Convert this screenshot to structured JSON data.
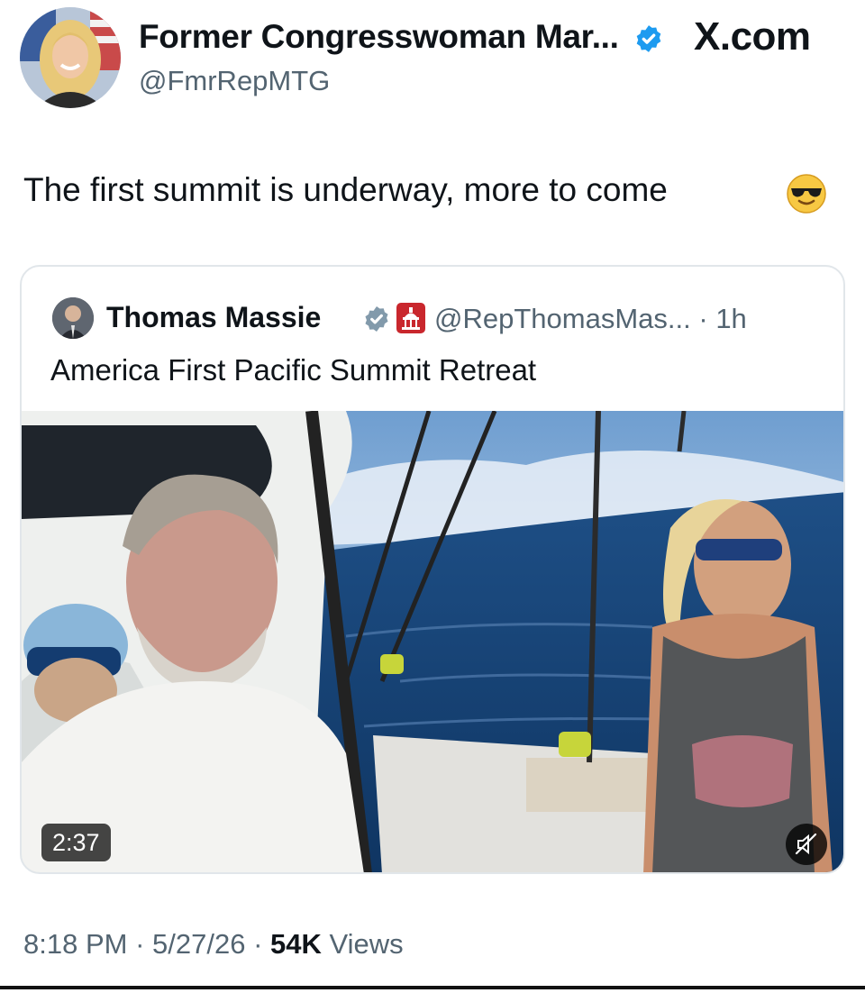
{
  "post": {
    "author": {
      "display_name": "Former Congresswoman Mar...",
      "handle": "@FmrRepMTG",
      "verified": true,
      "avatar_icon": "profile-avatar"
    },
    "source_site": "X.com",
    "text": "The first summit is underway, more to come",
    "emoji": "smiling-face-with-sunglasses",
    "quoted_post": {
      "author": {
        "display_name": "Thomas Massie",
        "handle": "@RepThomasMas...",
        "verified": true,
        "affiliation_badge": "capitol-badge-icon"
      },
      "separator": "·",
      "age": "1h",
      "text": "America First Pacific Summit Retreat",
      "media": {
        "type": "video",
        "duration": "2:37",
        "mute_icon": "speaker-muted-icon"
      }
    },
    "meta": {
      "time": "8:18 PM",
      "separator": "·",
      "date": "5/27/26",
      "views_count": "54K",
      "views_label": "Views"
    }
  },
  "colors": {
    "text": "#0f1419",
    "secondary_text": "#536471",
    "verified_blue": "#1d9bf0",
    "border": "#e1e6ea",
    "affiliation_red": "#c9272d"
  }
}
